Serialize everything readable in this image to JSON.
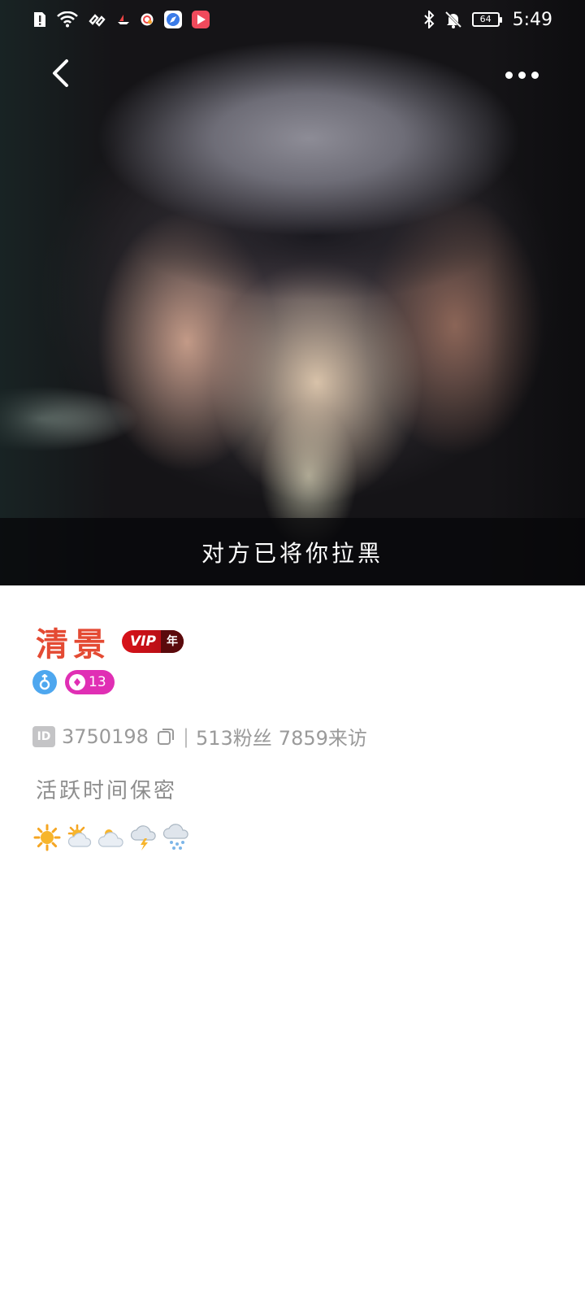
{
  "status_bar": {
    "time": "5:49",
    "battery": "64"
  },
  "banner": {
    "blocked_text": "对方已将你拉黑"
  },
  "profile": {
    "username": "清景",
    "vip_label": "VIP",
    "vip_period": "年",
    "level": "13",
    "id_label": "ID",
    "id_value": "3750198",
    "separator": "|",
    "fans": "513粉丝",
    "visitors": "7859来访",
    "active_status": "活跃时间保密"
  },
  "weather_icons": [
    "sun-icon",
    "sun-cloud-icon",
    "cloud-icon",
    "thunder-icon",
    "snow-icon"
  ],
  "colors": {
    "username": "#e44a33",
    "vip_red": "#d8121a",
    "gender_blue": "#4ea7ef",
    "level_pink": "#e02fb4",
    "muted_text": "#9a9a9a"
  }
}
